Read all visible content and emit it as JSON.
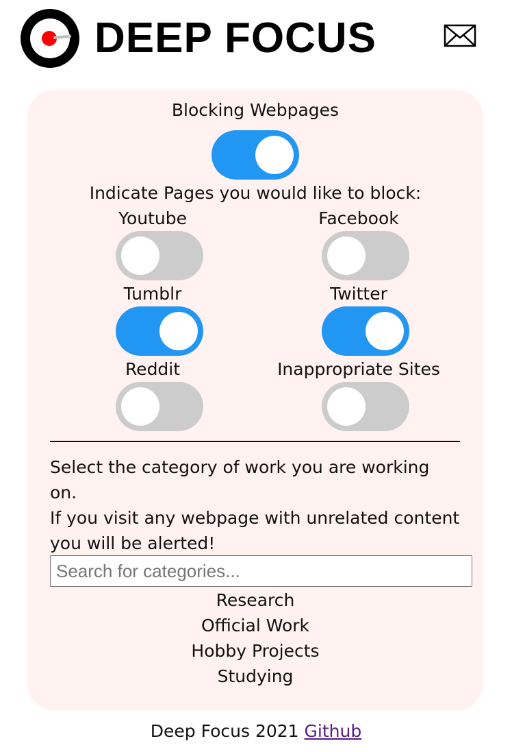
{
  "header": {
    "brand": "DEEP FOCUS",
    "logo_icon": "target-icon",
    "mail_icon": "envelope-icon"
  },
  "blocking": {
    "title": "Blocking Webpages",
    "enabled": true
  },
  "pages": {
    "prompt": "Indicate Pages you would like to block:",
    "items": [
      {
        "label": "Youtube",
        "on": false
      },
      {
        "label": "Facebook",
        "on": false
      },
      {
        "label": "Tumblr",
        "on": true
      },
      {
        "label": "Twitter",
        "on": true
      },
      {
        "label": "Reddit",
        "on": false
      },
      {
        "label": "Inappropriate Sites",
        "on": false
      }
    ]
  },
  "categories": {
    "instructions_line1": "Select the category of work you are working on.",
    "instructions_line2": "If you visit any webpage with unrelated content",
    "instructions_line3": "you will be alerted!",
    "search_placeholder": "Search for categories...",
    "items": [
      "Research",
      "Official Work",
      "Hobby Projects",
      "Studying"
    ]
  },
  "footer": {
    "text": "Deep Focus 2021",
    "link": "Github"
  },
  "colors": {
    "toggle_on": "#2196f3",
    "toggle_off": "#cccccc",
    "card_bg": "#fff2f0",
    "logo_red": "#ff0000",
    "link": "#551a8b"
  }
}
